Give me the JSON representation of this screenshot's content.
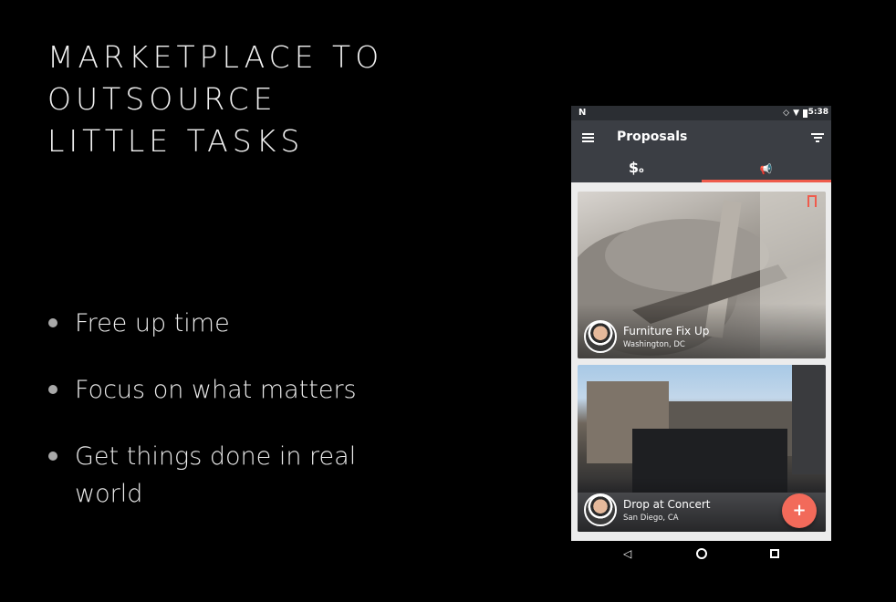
{
  "slide": {
    "title_lines": [
      "MARKETPLACE TO",
      "OUTSOURCE",
      "LITTLE TASKS"
    ],
    "bullets": [
      "Free up time",
      "Focus on what matters",
      "Get things done in real world"
    ]
  },
  "phone": {
    "status": {
      "carrier_icon": "N",
      "time": "5:38"
    },
    "appbar": {
      "title": "Proposals",
      "menu_icon": "hamburger-icon",
      "filter_icon": "filter-icon"
    },
    "tabs": [
      {
        "label": "$",
        "sub": "o",
        "icon": "money-tab-icon",
        "active": false
      },
      {
        "label": "📢",
        "icon": "megaphone-tab-icon",
        "active": true
      }
    ],
    "cards": [
      {
        "title": "Furniture Fix Up",
        "location": "Washington, DC"
      },
      {
        "title": "Drop at Concert",
        "location": "San Diego, CA"
      }
    ],
    "fab_label": "+",
    "nav": {
      "back": "◁",
      "home": "home-icon",
      "recent": "recent-apps-icon"
    }
  },
  "colors": {
    "accent": "#ef5b4c",
    "appbar": "#3b3e44",
    "background": "#000000"
  }
}
